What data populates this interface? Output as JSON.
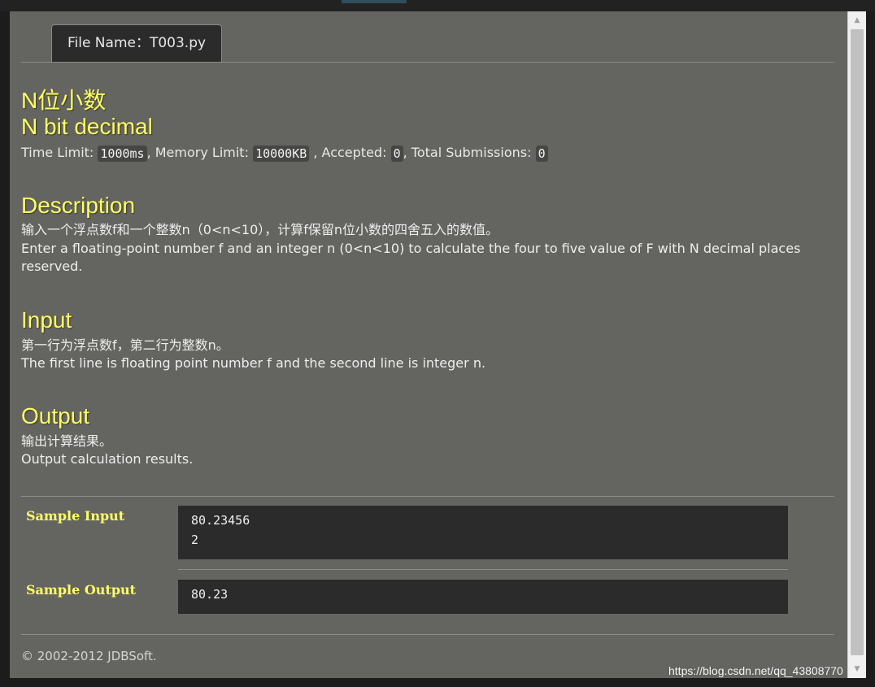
{
  "tab": {
    "label": "File Name：T003.py"
  },
  "problem": {
    "title_cn": "N位小数",
    "title_en": "N bit decimal"
  },
  "meta": {
    "time_limit_label": "Time Limit:",
    "time_limit_value": "1000ms",
    "memory_limit_label": ", Memory Limit:",
    "memory_limit_value": "10000KB",
    "accepted_label": ", Accepted:",
    "accepted_value": "0",
    "total_label": ", Total Submissions:",
    "total_value": "0"
  },
  "description": {
    "heading": "Description",
    "text_cn": "输入一个浮点数f和一个整数n（0<n<10），计算f保留n位小数的四舍五入的数值。",
    "text_en": "Enter a floating-point number f and an integer n (0<n<10) to calculate the four to five value of F with N decimal places reserved."
  },
  "input": {
    "heading": "Input",
    "text_cn": "第一行为浮点数f，第二行为整数n。",
    "text_en": "The first line is floating point number f and the second line is integer n."
  },
  "output": {
    "heading": "Output",
    "text_cn": "输出计算结果。",
    "text_en": "Output calculation results."
  },
  "samples": {
    "input_label": "Sample Input",
    "input_line1": "80.23456",
    "input_line2": "2",
    "output_label": "Sample Output",
    "output_value": "80.23"
  },
  "footer": {
    "text": "© 2002-2012 JDBSoft."
  },
  "watermark": {
    "text": "https://blog.csdn.net/qq_43808770"
  },
  "colors": {
    "heading": "#ffff66",
    "panel": "#646460",
    "code_bg": "#2b2b2b"
  }
}
